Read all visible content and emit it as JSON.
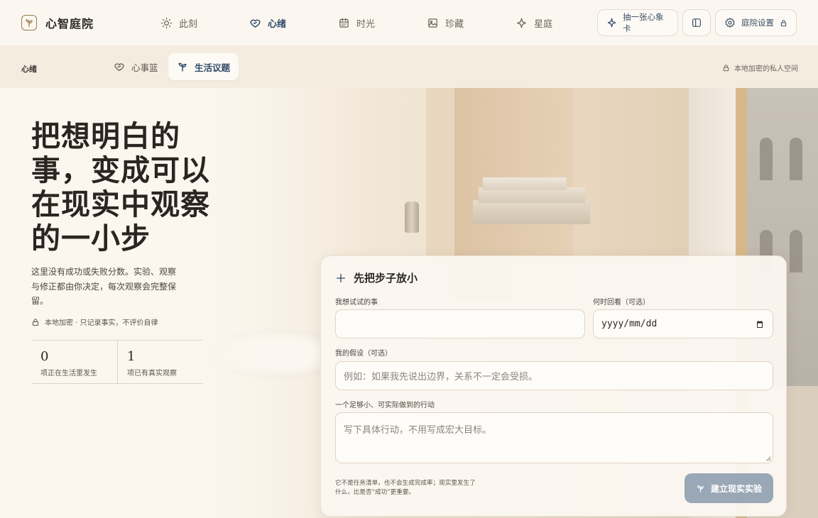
{
  "brand": {
    "name": "心智庭院"
  },
  "nav": {
    "items": [
      {
        "label": "此刻",
        "icon": "sun-icon"
      },
      {
        "label": "心绪",
        "icon": "heart-icon",
        "active": true
      },
      {
        "label": "时光",
        "icon": "calendar-icon"
      },
      {
        "label": "珍藏",
        "icon": "image-icon"
      },
      {
        "label": "星庭",
        "icon": "sparkle-icon"
      }
    ]
  },
  "toolbar": {
    "draw_card_label": "抽一张心象卡",
    "settings_label": "庭院设置"
  },
  "subnav": {
    "section": "心绪",
    "tabs": [
      {
        "label": "心事篮",
        "icon": "heart-icon"
      },
      {
        "label": "生活议题",
        "icon": "sprout-icon",
        "active": true
      }
    ],
    "privacy": "本地加密的私人空间"
  },
  "hero": {
    "title": "把想明白的事，变成可以在现实中观察的一小步",
    "description": "这里没有成功或失败分数。实验、观察与修正都由你决定，每次观察会完整保留。",
    "note": "本地加密 · 只记录事实，不评价自律",
    "stats": [
      {
        "value": "0",
        "label": "项正在生活里发生"
      },
      {
        "value": "1",
        "label": "项已有真实观察"
      }
    ]
  },
  "form": {
    "title": "先把步子放小",
    "thing_label": "我想试试的事",
    "thing_value": "",
    "review_label": "何时回看（可选）",
    "review_value": "yyyy/mm/dd",
    "hypothesis_label": "我的假设（可选）",
    "hypothesis_placeholder": "例如：如果我先说出边界，关系不一定会受损。",
    "action_label": "一个足够小、可实际做到的行动",
    "action_placeholder": "写下具体行动，不用写成宏大目标。",
    "footnote": "它不是任务清单，也不会生成完成率；现实里发生了什么，比是否“成功”更重要。",
    "submit_label": "建立现实实验"
  },
  "colors": {
    "accent": "#2f4a6a",
    "submit_bg": "#9aa7b6",
    "brand_icon": "#9a7a4c"
  }
}
